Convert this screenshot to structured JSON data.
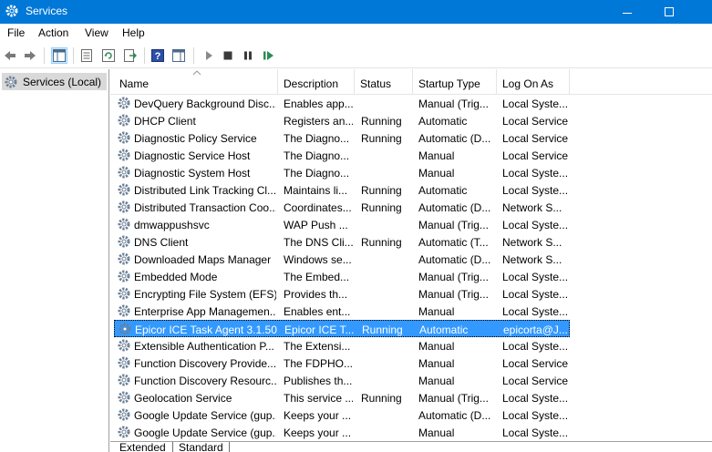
{
  "window": {
    "title": "Services",
    "app_icon": "gear-icon",
    "controls": [
      "minimize-icon",
      "maximize-icon"
    ]
  },
  "menu": [
    "File",
    "Action",
    "View",
    "Help"
  ],
  "toolbar": {
    "icons": [
      "back-arrow-icon",
      "forward-arrow-icon",
      "show-hide-tree-icon",
      "properties-icon",
      "refresh-icon",
      "export-list-icon",
      "help-icon",
      "show-hide-action-pane-icon",
      "start-service-icon",
      "stop-service-icon",
      "pause-service-icon",
      "restart-service-icon"
    ]
  },
  "tree": {
    "selected_label": "Services (Local)"
  },
  "columns": {
    "name": "Name",
    "description": "Description",
    "status": "Status",
    "startup_type": "Startup Type",
    "log_on_as": "Log On As"
  },
  "services": [
    {
      "name": "DevQuery Background Disc...",
      "description": "Enables app...",
      "status": "",
      "startup": "Manual (Trig...",
      "logon": "Local Syste..."
    },
    {
      "name": "DHCP Client",
      "description": "Registers an...",
      "status": "Running",
      "startup": "Automatic",
      "logon": "Local Service"
    },
    {
      "name": "Diagnostic Policy Service",
      "description": "The Diagno...",
      "status": "Running",
      "startup": "Automatic (D...",
      "logon": "Local Service"
    },
    {
      "name": "Diagnostic Service Host",
      "description": "The Diagno...",
      "status": "",
      "startup": "Manual",
      "logon": "Local Service"
    },
    {
      "name": "Diagnostic System Host",
      "description": "The Diagno...",
      "status": "",
      "startup": "Manual",
      "logon": "Local Syste..."
    },
    {
      "name": "Distributed Link Tracking Cl...",
      "description": "Maintains li...",
      "status": "Running",
      "startup": "Automatic",
      "logon": "Local Syste..."
    },
    {
      "name": "Distributed Transaction Coo...",
      "description": "Coordinates...",
      "status": "Running",
      "startup": "Automatic (D...",
      "logon": "Network S..."
    },
    {
      "name": "dmwappushsvc",
      "description": "WAP Push ...",
      "status": "",
      "startup": "Manual (Trig...",
      "logon": "Local Syste..."
    },
    {
      "name": "DNS Client",
      "description": "The DNS Cli...",
      "status": "Running",
      "startup": "Automatic (T...",
      "logon": "Network S..."
    },
    {
      "name": "Downloaded Maps Manager",
      "description": "Windows se...",
      "status": "",
      "startup": "Automatic (D...",
      "logon": "Network S..."
    },
    {
      "name": "Embedded Mode",
      "description": "The Embed...",
      "status": "",
      "startup": "Manual (Trig...",
      "logon": "Local Syste..."
    },
    {
      "name": "Encrypting File System (EFS)",
      "description": "Provides th...",
      "status": "",
      "startup": "Manual (Trig...",
      "logon": "Local Syste..."
    },
    {
      "name": "Enterprise App Managemen...",
      "description": "Enables ent...",
      "status": "",
      "startup": "Manual",
      "logon": "Local Syste..."
    },
    {
      "name": "Epicor ICE Task Agent 3.1.50...",
      "description": "Epicor ICE T...",
      "status": "Running",
      "startup": "Automatic",
      "logon": "epicorta@J..."
    },
    {
      "name": "Extensible Authentication P...",
      "description": "The Extensi...",
      "status": "",
      "startup": "Manual",
      "logon": "Local Syste..."
    },
    {
      "name": "Function Discovery Provide...",
      "description": "The FDPHO...",
      "status": "",
      "startup": "Manual",
      "logon": "Local Service"
    },
    {
      "name": "Function Discovery Resourc...",
      "description": "Publishes th...",
      "status": "",
      "startup": "Manual",
      "logon": "Local Service"
    },
    {
      "name": "Geolocation Service",
      "description": "This service ...",
      "status": "Running",
      "startup": "Manual (Trig...",
      "logon": "Local Syste..."
    },
    {
      "name": "Google Update Service (gup...",
      "description": "Keeps your ...",
      "status": "",
      "startup": "Automatic (D...",
      "logon": "Local Syste..."
    },
    {
      "name": "Google Update Service (gup...",
      "description": "Keeps your ...",
      "status": "",
      "startup": "Manual",
      "logon": "Local Syste..."
    }
  ],
  "selected_service_index": 13,
  "tabs": [
    "Extended",
    "Standard"
  ],
  "active_tab": "Standard",
  "colors": {
    "titlebar": "#0078d7",
    "selection": "#3399ff",
    "tree_selected": "#d9d9d9"
  }
}
